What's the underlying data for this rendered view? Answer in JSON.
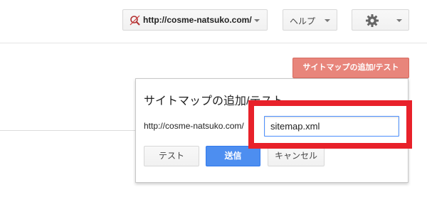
{
  "header": {
    "site_url": "http://cosme-natsuko.com/",
    "help_label": "ヘルプ",
    "settings_icon": "gear-icon",
    "site_icon": "search-not-verified-icon"
  },
  "sitemaps": {
    "add_test_button": "サイトマップの追加/テスト"
  },
  "dialog": {
    "title": "サイトマップの追加/テスト",
    "url_prefix": "http://cosme-natsuko.com/",
    "input_value": "sitemap.xml",
    "test_button": "テスト",
    "submit_button": "送信",
    "cancel_button": "キャンセル"
  },
  "colors": {
    "accent_red": "#e8857b",
    "submit_blue": "#4d8ef0",
    "highlight_red": "#e8212a",
    "input_focus": "#4d90fe"
  }
}
